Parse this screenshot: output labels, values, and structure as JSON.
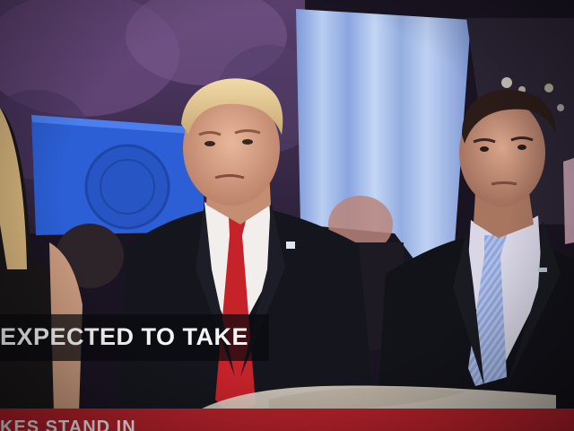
{
  "broadcast": {
    "caption": "EXPECTED TO TAKE",
    "ticker": "KES STAND IN"
  },
  "colors": {
    "ticker_red": "#b3202a",
    "caption_text": "#f4f4f4",
    "curtain_blue": "#9fb8e8",
    "flag_blue": "#2c5fd6",
    "tie_red": "#c5222a",
    "tie_blue": "#a9bbe6"
  }
}
